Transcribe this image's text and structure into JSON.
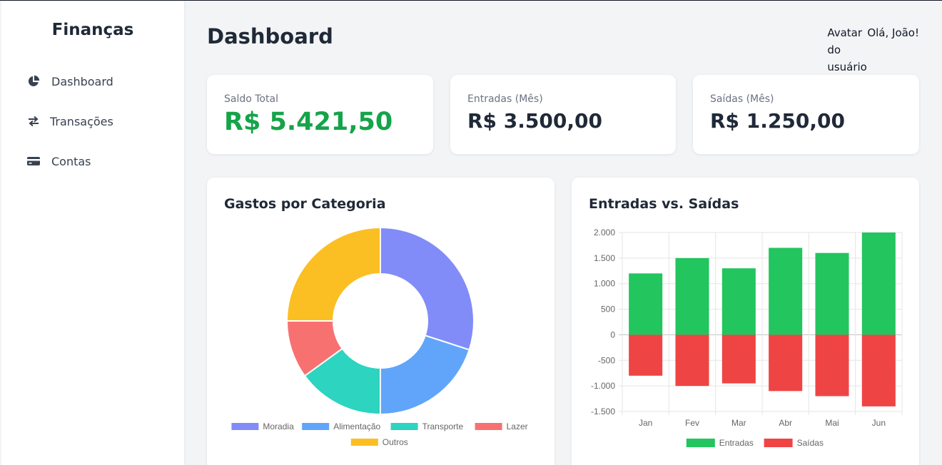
{
  "sidebar": {
    "brand": "Finanças",
    "items": [
      {
        "label": "Dashboard",
        "icon": "pie-chart-icon"
      },
      {
        "label": "Transações",
        "icon": "arrows-exchange-icon"
      },
      {
        "label": "Contas",
        "icon": "credit-card-icon"
      }
    ]
  },
  "header": {
    "title": "Dashboard",
    "avatar_alt": "Avatar do usuário",
    "greeting": "Olá, João!"
  },
  "stats": [
    {
      "label": "Saldo Total",
      "value": "R$ 5.421,50",
      "color": "#16a34a"
    },
    {
      "label": "Entradas (Mês)",
      "value": "R$ 3.500,00",
      "color": "#1f2937"
    },
    {
      "label": "Saídas (Mês)",
      "value": "R$ 1.250,00",
      "color": "#1f2937"
    }
  ],
  "panels": {
    "donut_title": "Gastos por Categoria",
    "bar_title": "Entradas vs. Saídas"
  },
  "chart_data": [
    {
      "type": "pie",
      "title": "Gastos por Categoria",
      "donut": true,
      "categories": [
        "Moradia",
        "Alimentação",
        "Transporte",
        "Lazer",
        "Outros"
      ],
      "values": [
        30,
        20,
        15,
        10,
        25
      ],
      "colors": [
        "#818cf8",
        "#60a5fa",
        "#2dd4bf",
        "#f87171",
        "#fbbf24"
      ],
      "legend": "bottom"
    },
    {
      "type": "bar",
      "title": "Entradas vs. Saídas",
      "categories": [
        "Jan",
        "Fev",
        "Mar",
        "Abr",
        "Mai",
        "Jun"
      ],
      "series": [
        {
          "name": "Entradas",
          "values": [
            1200,
            1500,
            1300,
            1700,
            1600,
            2000
          ],
          "color": "#22c55e"
        },
        {
          "name": "Saídas",
          "values": [
            -800,
            -1000,
            -950,
            -1100,
            -1200,
            -1400
          ],
          "color": "#ef4444"
        }
      ],
      "stacked": true,
      "ylim": [
        -1500,
        2000
      ],
      "yticks": [
        "2.000",
        "1.500",
        "1.000",
        "500",
        "0",
        "-500",
        "-1.000",
        "-1.500"
      ],
      "grid": true,
      "legend": "bottom"
    }
  ]
}
